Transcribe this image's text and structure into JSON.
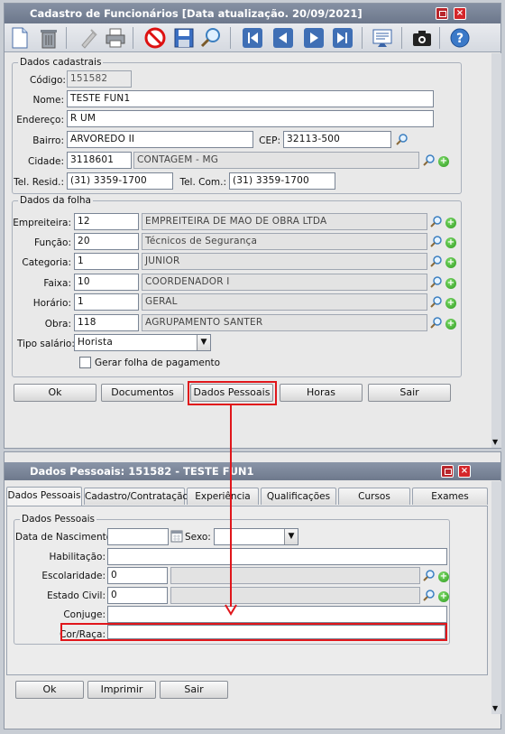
{
  "main_window": {
    "title": "Cadastro de Funcionários [Data atualização. 20/09/2021]",
    "dados_cadastrais": {
      "legend": "Dados cadastrais",
      "codigo_label": "Código:",
      "codigo": "151582",
      "nome_label": "Nome:",
      "nome": "TESTE FUN1",
      "endereco_label": "Endereço:",
      "endereco": "R UM",
      "bairro_label": "Bairro:",
      "bairro": "ARVOREDO II",
      "cep_label": "CEP:",
      "cep": "32113-500",
      "cidade_label": "Cidade:",
      "cidade_codigo": "3118601",
      "cidade_nome": "CONTAGEM - MG",
      "tel_resid_label": "Tel. Resid.:",
      "tel_resid": "(31) 3359-1700",
      "tel_com_label": "Tel. Com.:",
      "tel_com": "(31) 3359-1700"
    },
    "dados_folha": {
      "legend": "Dados da folha",
      "empreiteira_label": "Empreiteira:",
      "empreiteira_codigo": "12",
      "empreiteira_nome": "EMPREITEIRA DE MAO DE OBRA LTDA",
      "funcao_label": "Função:",
      "funcao_codigo": "20",
      "funcao_nome": "Técnicos de Segurança",
      "categoria_label": "Categoria:",
      "categoria_codigo": "1",
      "categoria_nome": "JUNIOR",
      "faixa_label": "Faixa:",
      "faixa_codigo": "10",
      "faixa_nome": "COORDENADOR I",
      "horario_label": "Horário:",
      "horario_codigo": "1",
      "horario_nome": "GERAL",
      "obra_label": "Obra:",
      "obra_codigo": "118",
      "obra_nome": "AGRUPAMENTO SANTER",
      "tipo_salario_label": "Tipo salário:",
      "tipo_salario": "Horista",
      "gerar_folha_label": "Gerar folha de pagamento"
    },
    "buttons": {
      "ok": "Ok",
      "documentos": "Documentos",
      "dados_pessoais": "Dados Pessoais",
      "horas": "Horas",
      "sair": "Sair"
    }
  },
  "dialog": {
    "title": "Dados Pessoais: 151582 - TESTE FUN1",
    "tabs": [
      "Dados Pessoais",
      "Cadastro/Contratação",
      "Experiência",
      "Qualificações",
      "Cursos",
      "Exames"
    ],
    "group_legend": "Dados Pessoais",
    "data_nascimento_label": "Data de Nascimento:",
    "data_nascimento": "",
    "sexo_label": "Sexo:",
    "sexo": "",
    "habilitacao_label": "Habilitação:",
    "habilitacao": "",
    "escolaridade_label": "Escolaridade:",
    "escolaridade": "0",
    "estado_civil_label": "Estado Civil:",
    "estado_civil": "0",
    "conjuge_label": "Conjuge:",
    "conjuge": "",
    "cor_raca_label": "Cor/Raça:",
    "cor_raca": "",
    "buttons": {
      "ok": "Ok",
      "imprimir": "Imprimir",
      "sair": "Sair"
    }
  },
  "colors": {
    "highlight": "#e0161b",
    "titlebar": "#7a8497"
  }
}
